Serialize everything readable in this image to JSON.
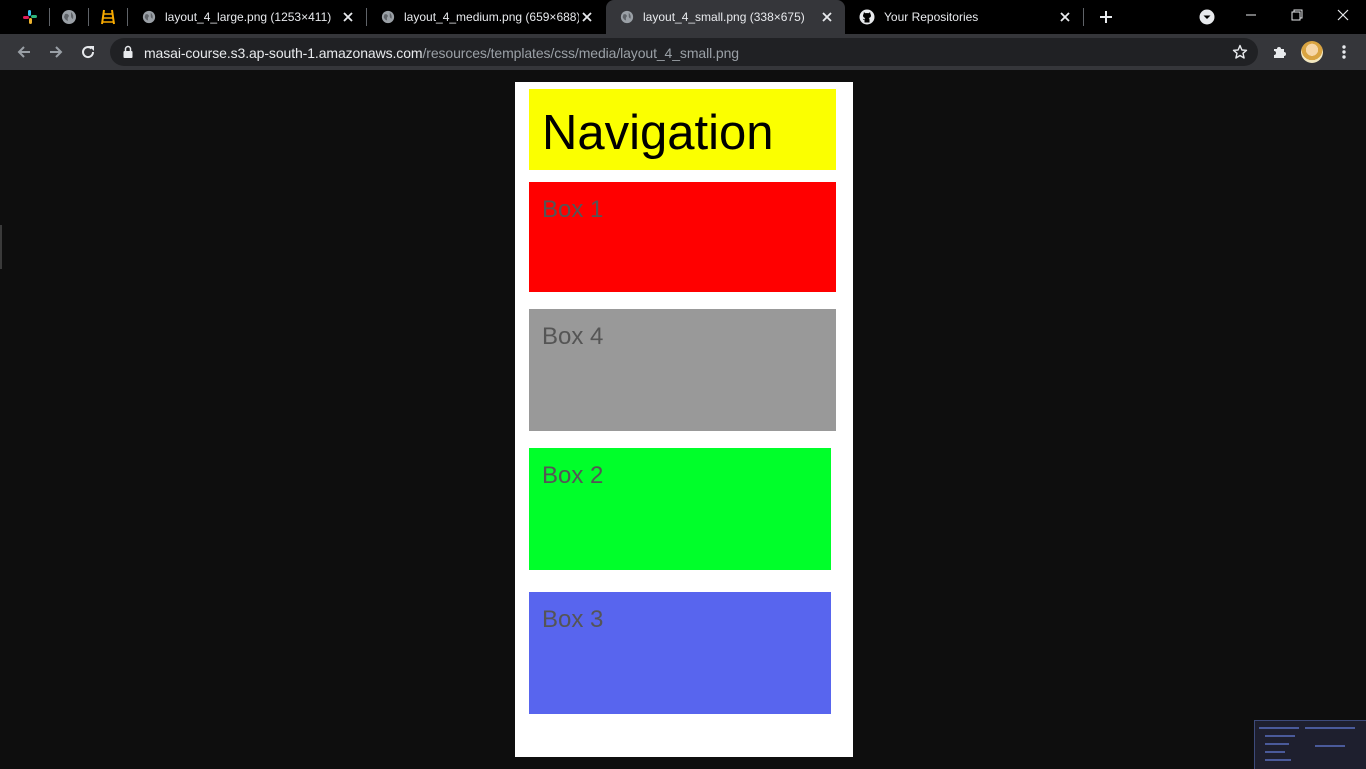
{
  "browser": {
    "tabs": [
      {
        "title": "layout_4_large.png (1253×411)",
        "active": false
      },
      {
        "title": "layout_4_medium.png (659×688)",
        "active": false
      },
      {
        "title": "layout_4_small.png (338×675)",
        "active": true
      },
      {
        "title": "Your Repositories",
        "active": false
      }
    ],
    "url_host": "masai-course.s3.ap-south-1.amazonaws.com",
    "url_path": "/resources/templates/css/media/layout_4_small.png"
  },
  "image": {
    "navigation": "Navigation",
    "boxes": [
      "Box 1",
      "Box 4",
      "Box 2",
      "Box 3"
    ]
  },
  "colors": {
    "navigation": "#fbff00",
    "box1": "#ff0000",
    "box4": "#999999",
    "box2": "#00ff2a",
    "box3": "#5865ee",
    "page_bg": "#0e0e0e",
    "tabstrip_bg": "#000000",
    "toolbar_bg": "#35363a"
  }
}
